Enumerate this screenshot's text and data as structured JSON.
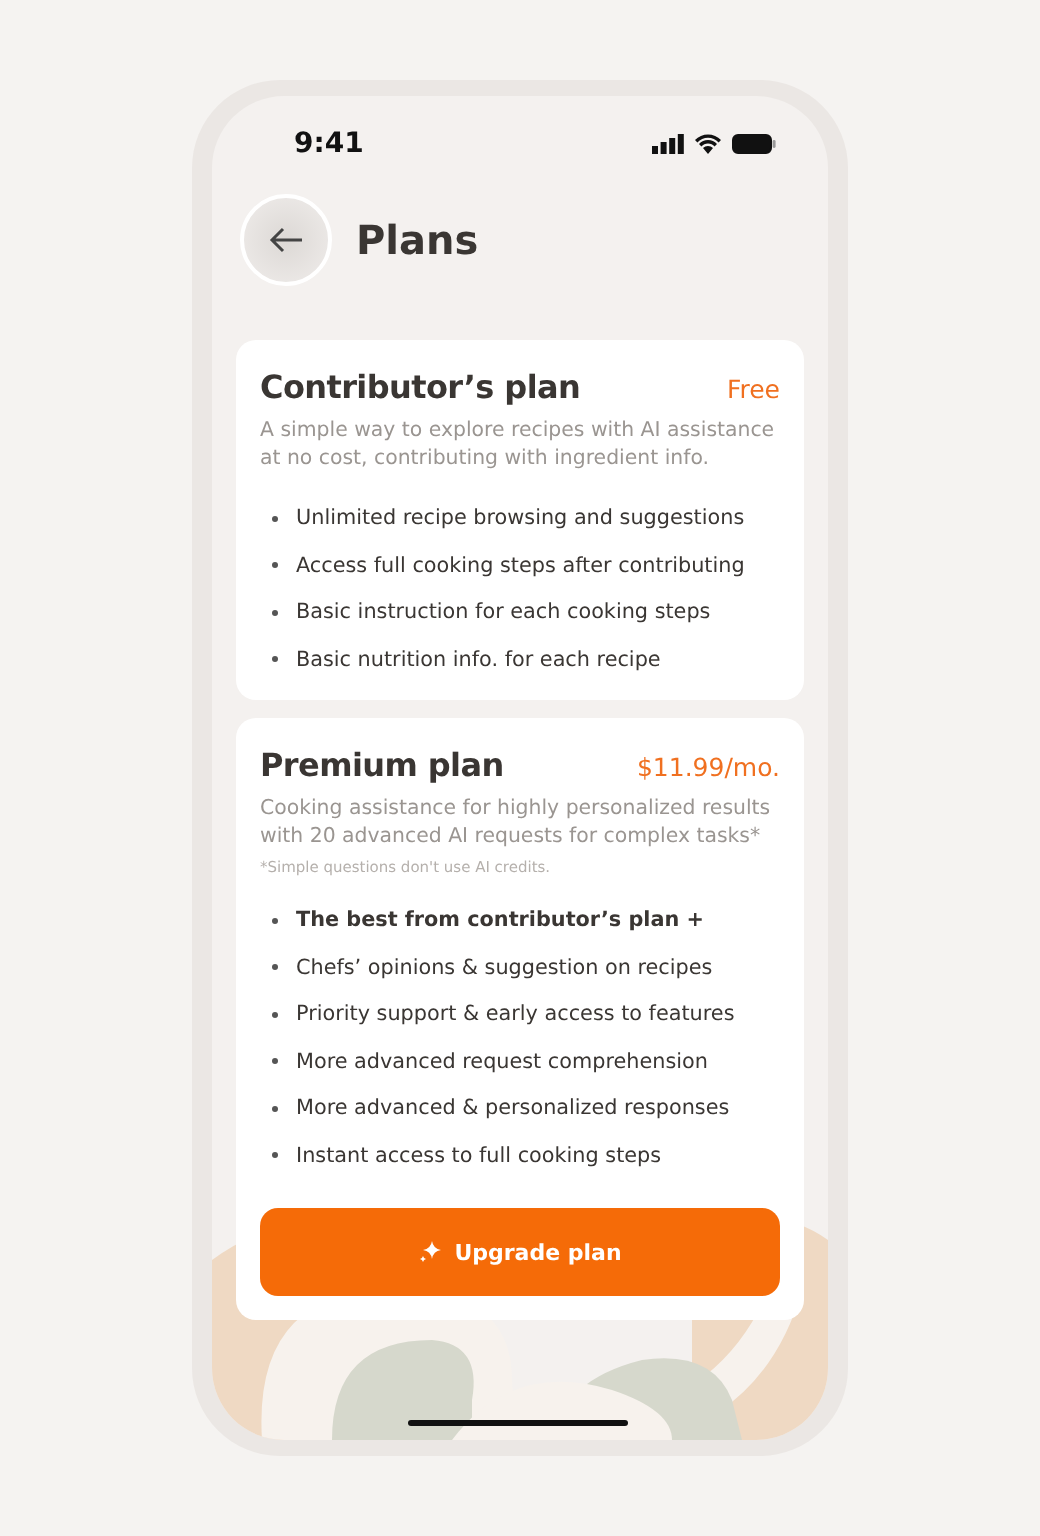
{
  "status_bar": {
    "time": "9:41"
  },
  "header": {
    "title": "Plans"
  },
  "plans": [
    {
      "name": "Contributor’s plan",
      "price": "Free",
      "description": "A simple way to explore recipes with AI assistance at no cost, contributing with ingredient info.",
      "features": [
        {
          "text": "Unlimited recipe browsing and suggestions",
          "emphasized": false
        },
        {
          "text": "Access full cooking steps after contributing",
          "emphasized": false
        },
        {
          "text": "Basic instruction for each cooking steps",
          "emphasized": false
        },
        {
          "text": "Basic nutrition info. for each recipe",
          "emphasized": false
        }
      ]
    },
    {
      "name": "Premium plan",
      "price": "$11.99/mo.",
      "description": "Cooking assistance for highly personalized results with 20 advanced AI requests for complex tasks*",
      "footnote": "*Simple questions don't use AI credits.",
      "features": [
        {
          "text": "The best from contributor’s plan +",
          "emphasized": true
        },
        {
          "text": "Chefs’ opinions & suggestion on recipes",
          "emphasized": false
        },
        {
          "text": "Priority support & early access to features",
          "emphasized": false
        },
        {
          "text": "More advanced request comprehension",
          "emphasized": false
        },
        {
          "text": "More advanced & personalized responses",
          "emphasized": false
        },
        {
          "text": "Instant access to full cooking steps",
          "emphasized": false
        }
      ],
      "button": "Upgrade plan"
    }
  ]
}
